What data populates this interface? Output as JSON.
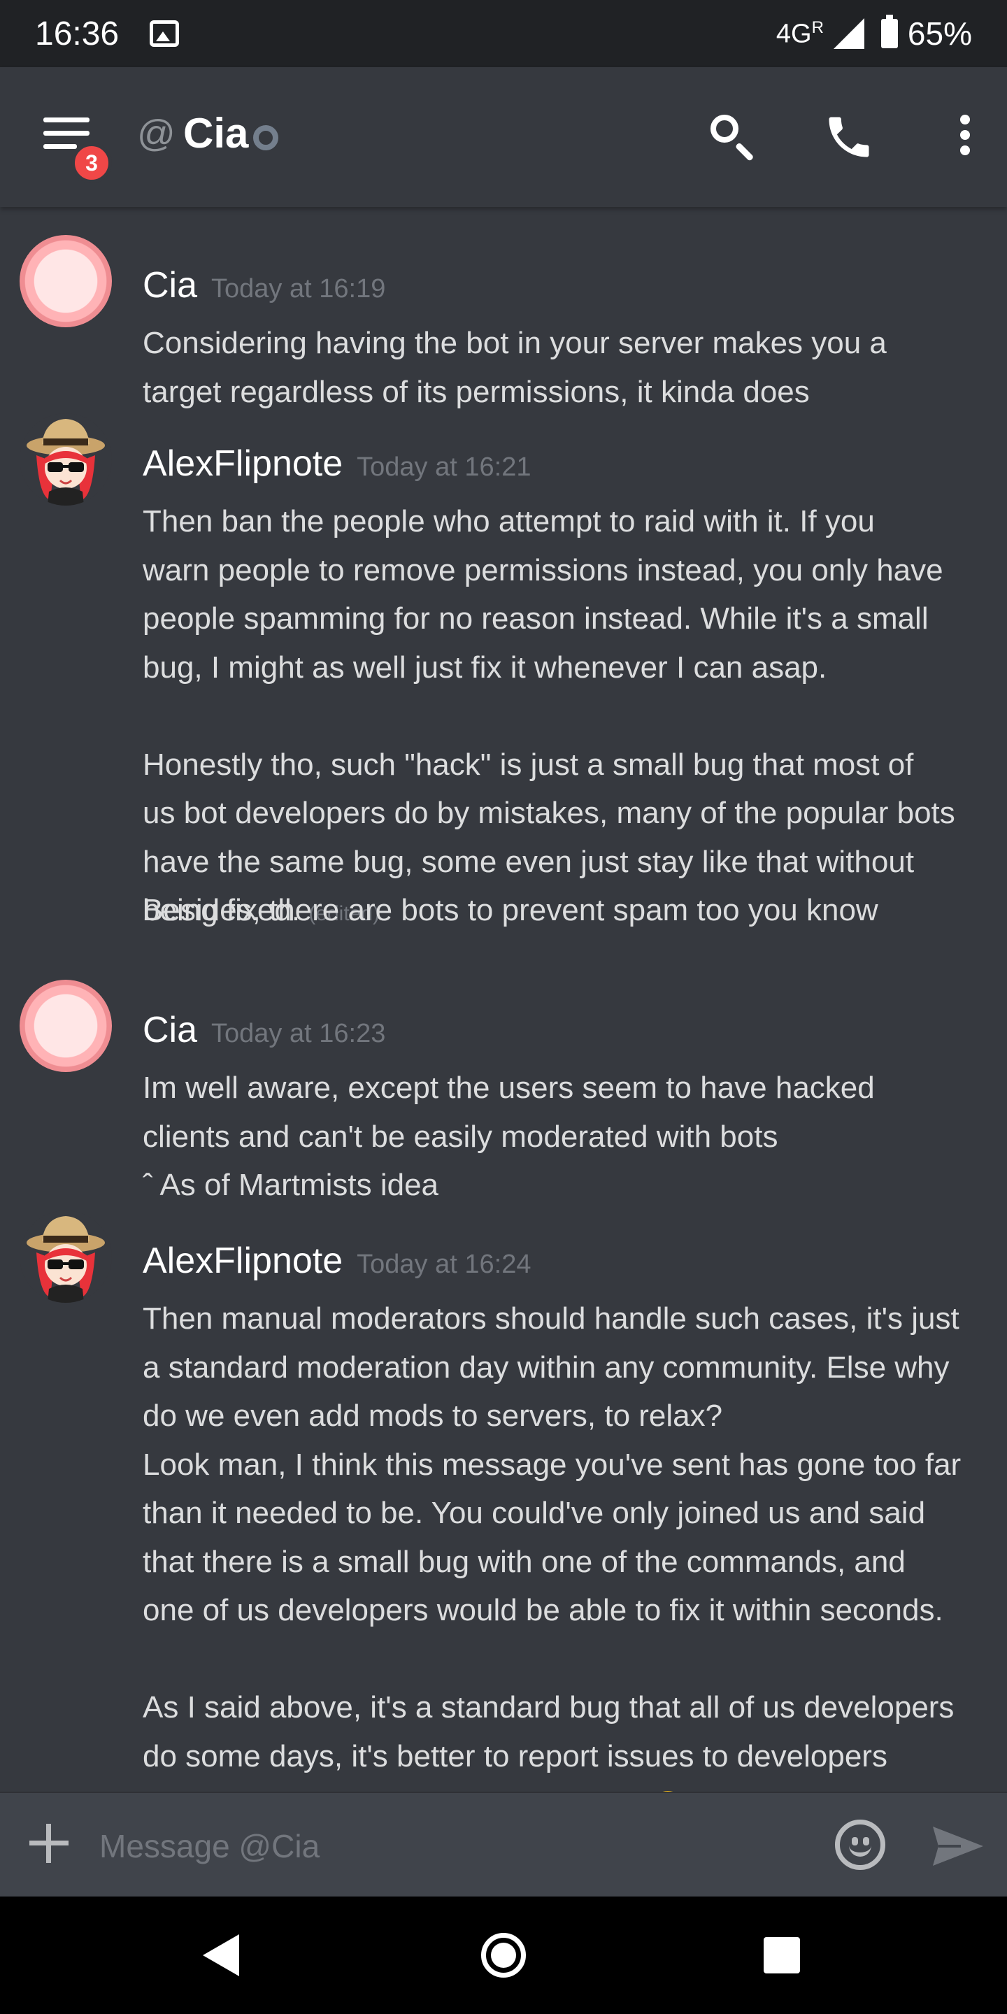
{
  "status_bar": {
    "time": "16:36",
    "network": "4G",
    "roaming": "R",
    "battery": "65%"
  },
  "header": {
    "unread_count": "3",
    "at_symbol": "@",
    "channel_name": "Cia"
  },
  "messages": [
    {
      "author": "Cia",
      "timestamp": "Today at 16:19",
      "lines": [
        "Considering having the bot in your server makes you a\ntarget regardless of its permissions, it kinda does"
      ]
    },
    {
      "author": "AlexFlipnote",
      "timestamp": "Today at 16:21",
      "lines": [
        "Then ban the people who attempt to raid with it. If you\nwarn people to remove permissions instead, you only have\npeople spamming for no reason instead. While it's a small\nbug, I might as well just fix it whenever I can asap.\n\nHonestly tho, such \"hack\" is just a small bug that most of\nus bot developers do by mistakes, many of the popular bots\nhave the same bug, some even just stay like that without\nbeing fixed.",
        "Besides, there are bots to prevent spam too you know"
      ],
      "edited": "(edited)"
    },
    {
      "author": "Cia",
      "timestamp": "Today at 16:23",
      "lines": [
        "Im well aware, except the users seem to have hacked\nclients and can't be easily moderated with bots\nˆ As of Martmists idea"
      ]
    },
    {
      "author": "AlexFlipnote",
      "timestamp": "Today at 16:24",
      "lines": [
        "Then manual moderators should handle such cases, it's just\na standard moderation day within any community. Else why\ndo we even add mods to servers, to relax?\nLook man, I think this message you've sent has gone too far\nthan it needed to be. You could've only joined us and said\nthat there is a small bug with one of the commands, and\none of us developers would be able to fix it within seconds.\n\nAs I said above, it's a standard bug that all of us developers\ndo some days, it's better to report issues to developers\nthen spreading over saturated words"
      ]
    }
  ],
  "composer": {
    "placeholder": "Message @Cia"
  }
}
